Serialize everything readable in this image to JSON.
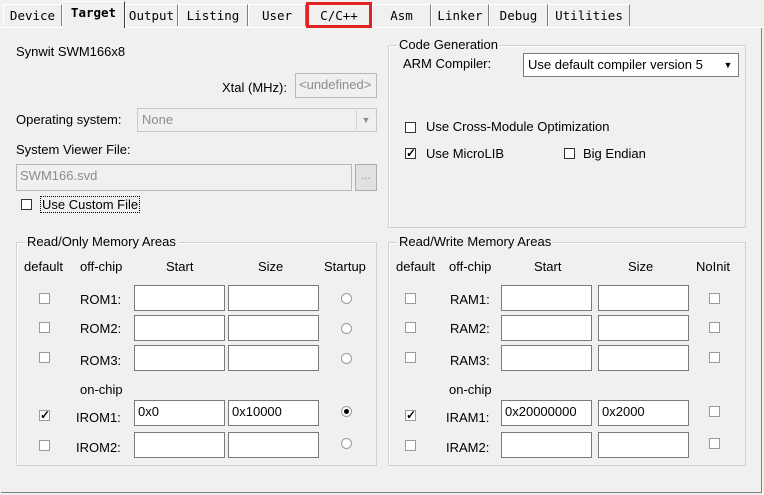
{
  "tabs": [
    {
      "label": "Device",
      "active": false
    },
    {
      "label": "Target",
      "active": true
    },
    {
      "label": "Output",
      "active": false
    },
    {
      "label": "Listing",
      "active": false
    },
    {
      "label": "User",
      "active": false
    },
    {
      "label": "C/C++",
      "active": false,
      "highlighted": true
    },
    {
      "label": "Asm",
      "active": false
    },
    {
      "label": "Linker",
      "active": false
    },
    {
      "label": "Debug",
      "active": false
    },
    {
      "label": "Utilities",
      "active": false
    }
  ],
  "target": {
    "device_name": "Synwit SWM166x8",
    "xtal_label": "Xtal (MHz):",
    "xtal_value": "<undefined>",
    "os_label": "Operating system:",
    "os_value": "None",
    "svd_label": "System Viewer File:",
    "svd_value": "SWM166.svd",
    "svd_browse": "...",
    "custom_file_label": "Use Custom File",
    "custom_file_checked": false
  },
  "codegen": {
    "title": "Code Generation",
    "compiler_label": "ARM Compiler:",
    "compiler_value": "Use default compiler version 5",
    "cross_module_label": "Use Cross-Module Optimization",
    "cross_module_checked": false,
    "microlib_label": "Use MicroLIB",
    "microlib_checked": true,
    "big_endian_label": "Big Endian",
    "big_endian_checked": false
  },
  "ro_memory": {
    "title": "Read/Only Memory Areas",
    "headers": {
      "default": "default",
      "offchip": "off-chip",
      "start": "Start",
      "size": "Size",
      "startup": "Startup"
    },
    "onchip_label": "on-chip",
    "rows": [
      {
        "name": "ROM1:",
        "default": false,
        "start": "",
        "size": "",
        "startup": false
      },
      {
        "name": "ROM2:",
        "default": false,
        "start": "",
        "size": "",
        "startup": false
      },
      {
        "name": "ROM3:",
        "default": false,
        "start": "",
        "size": "",
        "startup": false
      },
      {
        "name": "IROM1:",
        "default": true,
        "start": "0x0",
        "size": "0x10000",
        "startup": true
      },
      {
        "name": "IROM2:",
        "default": false,
        "start": "",
        "size": "",
        "startup": false
      }
    ]
  },
  "rw_memory": {
    "title": "Read/Write Memory Areas",
    "headers": {
      "default": "default",
      "offchip": "off-chip",
      "start": "Start",
      "size": "Size",
      "noinit": "NoInit"
    },
    "onchip_label": "on-chip",
    "rows": [
      {
        "name": "RAM1:",
        "default": false,
        "start": "",
        "size": "",
        "noinit": false
      },
      {
        "name": "RAM2:",
        "default": false,
        "start": "",
        "size": "",
        "noinit": false
      },
      {
        "name": "RAM3:",
        "default": false,
        "start": "",
        "size": "",
        "noinit": false
      },
      {
        "name": "IRAM1:",
        "default": true,
        "start": "0x20000000",
        "size": "0x2000",
        "noinit": false
      },
      {
        "name": "IRAM2:",
        "default": false,
        "start": "",
        "size": "",
        "noinit": false
      }
    ]
  }
}
